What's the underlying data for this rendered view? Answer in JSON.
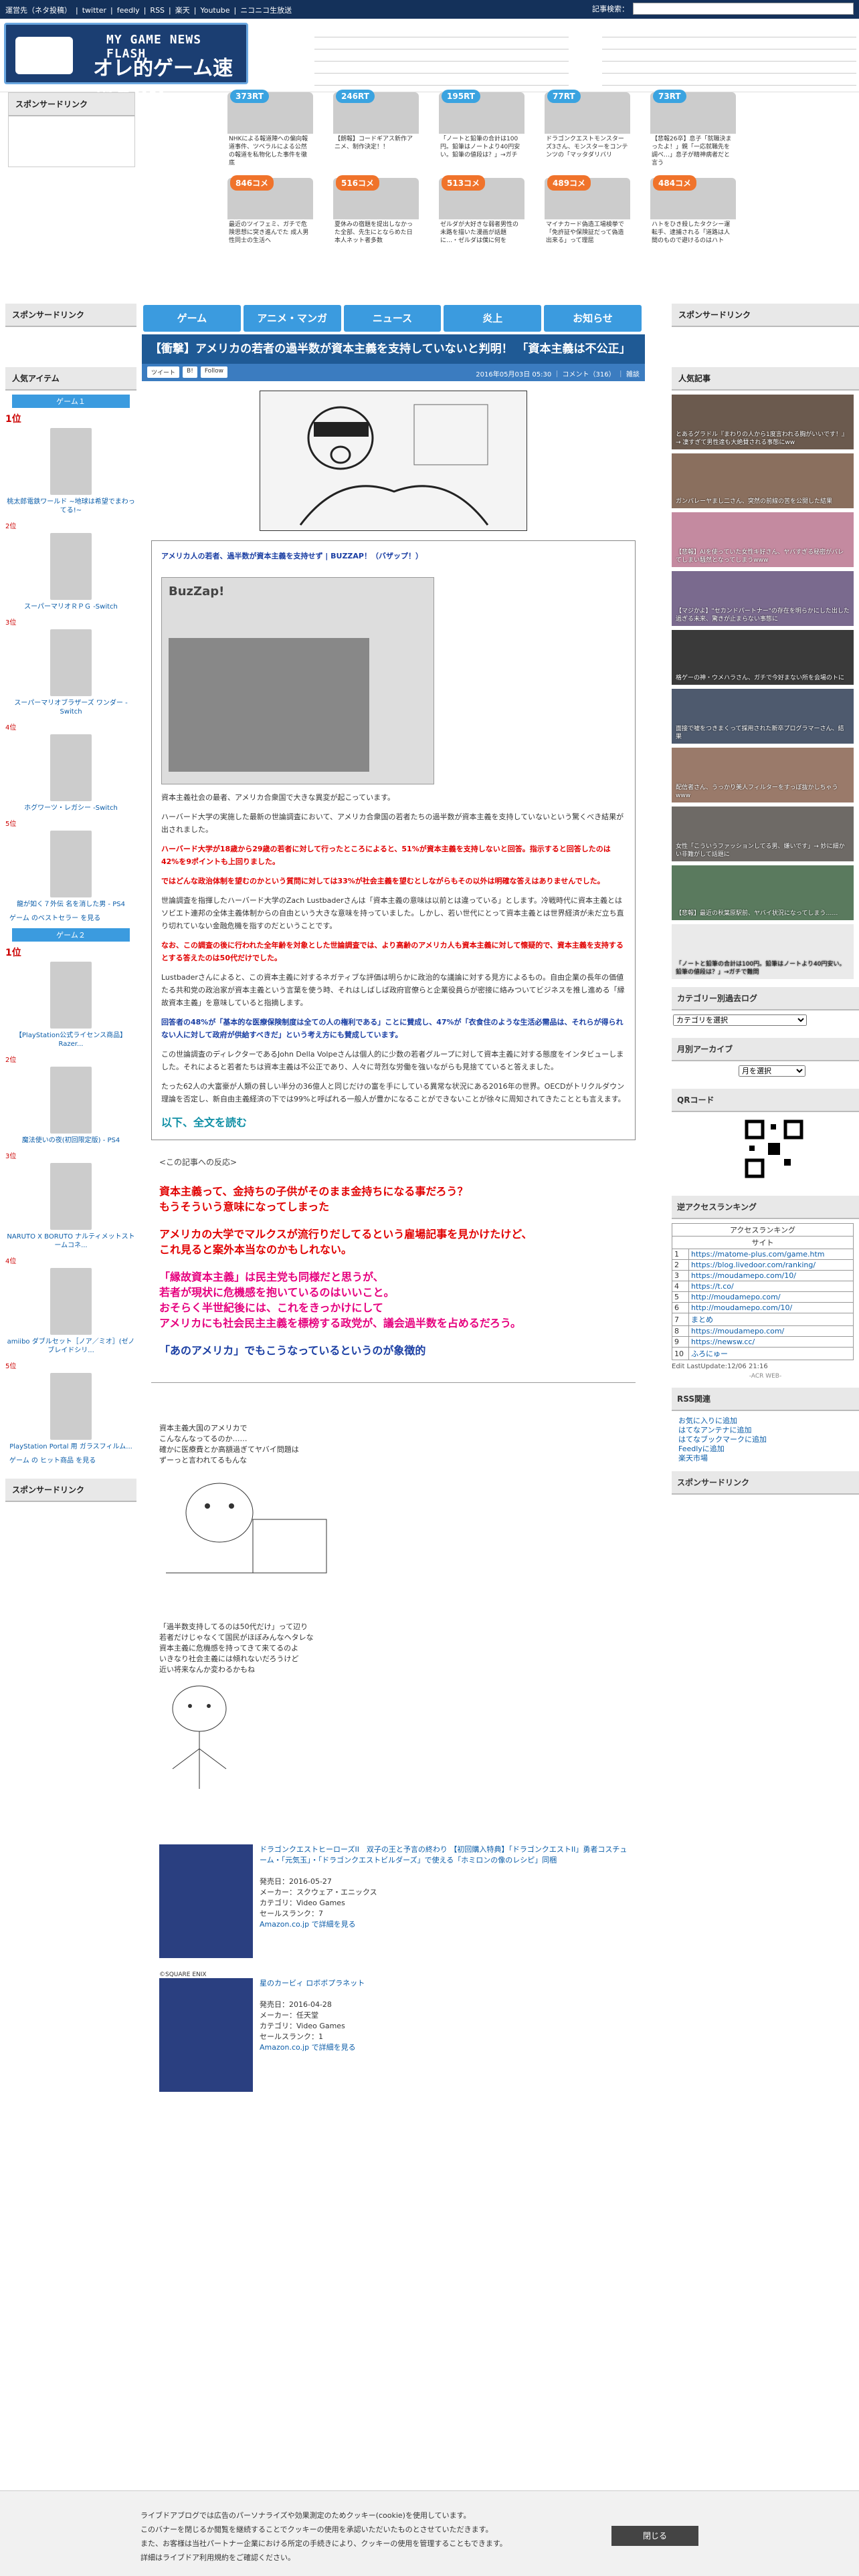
{
  "topbar": {
    "links": [
      "運営先（ネタ投稿）",
      "twitter",
      "feedly",
      "RSS",
      "楽天",
      "Youtube",
      "ニコニコ生放送"
    ],
    "search_label": "記事検索："
  },
  "logo": {
    "sub": "MY GAME NEWS FLASH",
    "title": "オレ的ゲーム速報@JIN"
  },
  "sponsor_link": "スポンサードリンク",
  "rank_cards": [
    {
      "badge": "373RT",
      "type": "rt",
      "text": "NHKによる報道陣への偏向報道事件、ツベラルによる公然の報道を私物化した事件を徹底"
    },
    {
      "badge": "246RT",
      "type": "rt",
      "text": "【朗報】コードギアス新作アニメ、制作決定！！"
    },
    {
      "badge": "195RT",
      "type": "rt",
      "text": "「ノートと鉛筆の合計は100円。鉛筆はノートより40円安い。鉛筆の値段は？」→ガチ"
    },
    {
      "badge": "77RT",
      "type": "rt",
      "text": "ドラゴンクエストモンスターズ3さん、モンスターをコンテンツの「マッタダリバリ"
    },
    {
      "badge": "73RT",
      "type": "rt",
      "text": "【悲報26卒】息子「就職決まったよ！」親「一応就職先を調べ…」息子が精神病者だと言う"
    },
    {
      "badge": "846コメ",
      "type": "c",
      "text": "最近のツイフェミ、ガチで危険思想に突き進んでた 成人男性同士の生活へ"
    },
    {
      "badge": "516コメ",
      "type": "c",
      "text": "夏休みの宿題を提出しなかった全部、先生にとならめた日本人ネット者多数"
    },
    {
      "badge": "513コメ",
      "type": "c",
      "text": "ゼルダが大好きな弱者男性の未路を描いた漫画が話題に…・ゼルダは僕に何を"
    },
    {
      "badge": "489コメ",
      "type": "c",
      "text": "マイナカード偽造工場検挙で「免許証や保険証だって偽造出来る」って理屈"
    },
    {
      "badge": "484コメ",
      "type": "c",
      "text": "ハトをひき殺したタクシー運転手、逮捕される「道路は人間のもので避けるのはハト"
    }
  ],
  "nav": [
    "ゲーム",
    "アニメ・マンガ",
    "ニュース",
    "炎上",
    "お知らせ"
  ],
  "left": {
    "sponsor": "スポンサードリンク",
    "popular_items": "人気アイテム",
    "game1_bar": "ゲーム１",
    "game1": [
      {
        "rank": "1位",
        "title": "桃太郎電鉄ワールド ~地球は希望でまわってる!~"
      },
      {
        "rank": "2位",
        "title": "スーパーマリオＲＰＧ -Switch"
      },
      {
        "rank": "3位",
        "title": "スーパーマリオブラザーズ ワンダー -Switch"
      },
      {
        "rank": "4位",
        "title": "ホグワーツ・レガシー -Switch"
      },
      {
        "rank": "5位",
        "title": "龍が如く７外伝 名を消した男 - PS4"
      }
    ],
    "game1_more": "ゲーム のベストセラー を見る",
    "game2_bar": "ゲーム２",
    "game2": [
      {
        "rank": "1位",
        "title": "【PlayStation公式ライセンス商品】 Razer..."
      },
      {
        "rank": "2位",
        "title": "魔法使いの夜(初回限定版) - PS4"
      },
      {
        "rank": "3位",
        "title": "NARUTO X BORUTO ナルティメットストームコネ..."
      },
      {
        "rank": "4位",
        "title": "amiibo ダブルセット［ノア／ミオ］(ゼノブレイドシリ..."
      },
      {
        "rank": "5位",
        "title": "PlayStation Portal 用 ガラスフィルム..."
      }
    ],
    "game2_more": "ゲーム の ヒット商品 を見る",
    "sponsor2": "スポンサードリンク"
  },
  "article": {
    "title": "【衝撃】アメリカの若者の過半数が資本主義を支持していないと判明！ 「資本主義は不公正」",
    "share": [
      "ツイート",
      "B!",
      "Follow"
    ],
    "meta": "2016年05月03日 05:30 ｜ コメント（316） ｜ 雑談",
    "link": "アメリカ人の若者、過半数が資本主義を支持せず | BUZZAP！（バザップ！）",
    "paras": [
      {
        "style": "",
        "text": "資本主義社会の最者、アメリカ合衆国で大きな異変が起こっています。"
      },
      {
        "style": "",
        "text": "ハーバード大学の実施した最新の世論調査において、アメリカ合衆国の若者たちの過半数が資本主義を支持していないという驚くべき結果が出されました。"
      },
      {
        "style": "red",
        "text": "ハーバード大学が18歳から29歳の若者に対して行ったところによると、51%が資本主義を支持しないと回答。指示すると回答したのは42%を9ポイントも上回りました。"
      },
      {
        "style": "red",
        "text": "ではどんな政治体制を望むのかという質問に対しては33%が社会主義を望むとしながらもその以外は明確な答えはありませんでした。"
      },
      {
        "style": "",
        "text": "世論調査を指揮したハーバード大学のZach Lustbaderさんは「資本主義の意味は以前とは違っている」とします。冷戦時代に資本主義とはソビエト連邦の全体主義体制からの自由という大きな意味を持っていました。しかし、若い世代にとって資本主義とは世界経済が未だ立ち直り切れていない金融危機を指すのだということです。"
      },
      {
        "style": "red",
        "text": "なお、この調査の後に行われた全年齢を対象とした世論調査では、より高齢のアメリカ人も資本主義に対して懐疑的で、資本主義を支持するとする答えたのは50代だけでした。"
      },
      {
        "style": "",
        "text": "Lustbaderさんによると、この資本主義に対するネガティブな評価は明らかに政治的な議論に対する見方によるもの。自由企業の長年の価値たる共和党の政治家が資本主義という言葉を使う時、それはしばしば政府官僚らと企業役員らが密接に絡みついてビジネスを推し進める「縁故資本主義」を意味していると指摘します。"
      },
      {
        "style": "blue",
        "text": "回答者の48%が「基本的な医療保険制度は全ての人の権利である」ことに賛成し、47%が「衣食住のような生活必需品は、それらが得られない人に対して政府が供給すべきだ」という考え方にも賛成しています。"
      },
      {
        "style": "",
        "text": "この世論調査のディレクターであるJohn Della Volpeさんは個人的に少数の若者グループに対して資本主義に対する態度をインタビューしました。それによると若者たちは資本主義は不公正であり、人々に苛烈な労働を強いながらも見捨てていると答えました。"
      },
      {
        "style": "",
        "text": "たった62人の大富豪が人類の貧しい半分の36億人と同じだけの富を手にしている異常な状況にある2016年の世界。OECDがトリクルダウン理論を否定し、新自由主義経済の下では99%と呼ばれる一般人が豊かになることができないことが徐々に周知されてきたこととも言えます。"
      }
    ],
    "read_more": "以下、全文を読む",
    "reaction": "<この記事への反応>",
    "comment_lines": [
      {
        "style": "red",
        "text": "資本主義って、金持ちの子供がそのまま金持ちになる事だろう？"
      },
      {
        "style": "red",
        "text": "もうそういう意味になってしまった"
      },
      {
        "style": "red",
        "text": "アメリカの大学でマルクスが流行りだしてるという雇場記事を見かけたけど、"
      },
      {
        "style": "red",
        "text": "これ見ると案外本当なのかもしれない。"
      },
      {
        "style": "pink",
        "text": "「縁故資本主義」は民主党も同様だと思うが、"
      },
      {
        "style": "pink",
        "text": "若者が現状に危機感を抱いているのはいいこと。"
      },
      {
        "style": "pink",
        "text": "おそらく半世紀後には、これをきっかけにして"
      },
      {
        "style": "pink",
        "text": "アメリカにも社会民主主義を標榜する政党が、議会過半数を占めるだろう。"
      },
      {
        "style": "blue",
        "text": "「あのアメリカ」でもこうなっているというのが象徴的"
      }
    ],
    "aa1": [
      "資本主義大国のアメリカで",
      "こんなんなってるのか……",
      "確かに医療費とか高額過ぎてヤバイ問題は",
      "ずーっと言われてるもんな"
    ],
    "aa2": [
      "「過半数支持してるのは50代だけ」って辺り",
      "若者だけじゃなくて国民がほぼみんなヘタレな",
      "資本主義に危機感を持ってきて来てるのよ",
      "いきなり社会主義には傾れないだろうけど",
      "近い将来なんか変わるかもね"
    ],
    "products": [
      {
        "title": "ドラゴンクエストヒーローズII　双子の王と予言の終わり 【初回購入特典】「ドラゴンクエストII」勇者コスチューム・「元気玉」・「ドラゴンクエストビルダーズ」で使える「ホミロンの像のレシピ」同梱",
        "lines": [
          "発売日：2016-05-27",
          "メーカー：スクウェア・エニックス",
          "カテゴリ：Video Games",
          "セールスランク：7"
        ],
        "link": "Amazon.co.jp で詳細を見る",
        "copy": "©SQUARE ENIX"
      },
      {
        "title": "星のカービィ ロボボプラネット",
        "lines": [
          "発売日：2016-04-28",
          "メーカー：任天堂",
          "カテゴリ：Video Games",
          "セールスランク：1"
        ],
        "link": "Amazon.co.jp で詳細を見る",
        "copy": ""
      }
    ]
  },
  "right": {
    "sponsor": "スポンサードリンク",
    "popular": "人気記事",
    "popular_items": [
      "とあるグラドル『まわりの人から1度言われる胸がいいです！』→ 凄すぎて男性達も大絶賛される事態にww",
      "ガンバレーヤまし二さん、突然の前線の苦を公開した結果",
      "【悲報】AIを使っていた女性キ好さん、ヤバすぎる秘密がバレてしまい騒然となってしまうwww",
      "【マジかよ】\"セカンドパートナー\"の存在を明らかにした出した過ぎる未来、驚きが止まらない事態に",
      "格ゲーの神・ウメハラさん、ガチで今好まない所を会場のトに",
      "面接で嘘をつきまくって採用された新卒プログラマーさん、結果",
      "配信者さん、うっかり美人フィルターをすっぽ抜かしちゃうwww",
      "女性「こういうファッションしてる男、嫌いです」→ 妙に細かい非難がして話題に",
      "【悲報】最近の秋葉原駅前、ヤバイ状況になってしまう……",
      "「ノートと鉛筆の合計は100円。鉛筆はノートより40円安い。鉛筆の値段は？」→ガチで難問"
    ],
    "category": "カテゴリー別過去ログ",
    "category_select": "カテゴリを選択",
    "monthly": "月別アーカイブ",
    "monthly_select": "月を選択",
    "qr": "QRコード",
    "access": "逆アクセスランキング",
    "access_head": "アクセスランキング",
    "access_sub": "サイト",
    "access_rows": [
      {
        "n": "1",
        "url": "https://matome-plus.com/game.htm"
      },
      {
        "n": "2",
        "url": "https://blog.livedoor.com/ranking/"
      },
      {
        "n": "3",
        "url": "https://moudamepo.com/10/"
      },
      {
        "n": "4",
        "url": "https://t.co/"
      },
      {
        "n": "5",
        "url": "http://moudamepo.com/"
      },
      {
        "n": "6",
        "url": "http://moudamepo.com/10/"
      },
      {
        "n": "7",
        "url": "まとめ"
      },
      {
        "n": "8",
        "url": "https://moudamepo.com/"
      },
      {
        "n": "9",
        "url": "https://newsw.cc/"
      },
      {
        "n": "10",
        "url": "ふろにゅー"
      }
    ],
    "access_footer": "Edit LastUpdate:12/06 21:16",
    "access_footer2": "-ACR WEB-",
    "rss": "RSS関連",
    "rss_links": [
      "お気に入りに追加",
      "はてなアンテナに追加",
      "はてなブックマークに追加",
      "Feedlyに追加",
      "楽天市場"
    ],
    "sponsor2": "スポンサードリンク"
  },
  "cookie": {
    "lines": [
      "ライブドアブログでは広告のパーソナライズや効果測定のためクッキー(cookie)を使用しています。",
      "このバナーを閉じるか閲覧を継続することでクッキーの使用を承認いただいたものとさせていただきます。",
      "また、お客様は当社パートナー企業における所定の手続きにより、クッキーの使用を管理することもできます。",
      "詳細はライブドア利用規約をご確認ください。"
    ],
    "close": "閉じる"
  },
  "colors": {
    "nav": "#3b9bdf",
    "title_bg": "#1f5a95",
    "topbar": "#14315a"
  }
}
